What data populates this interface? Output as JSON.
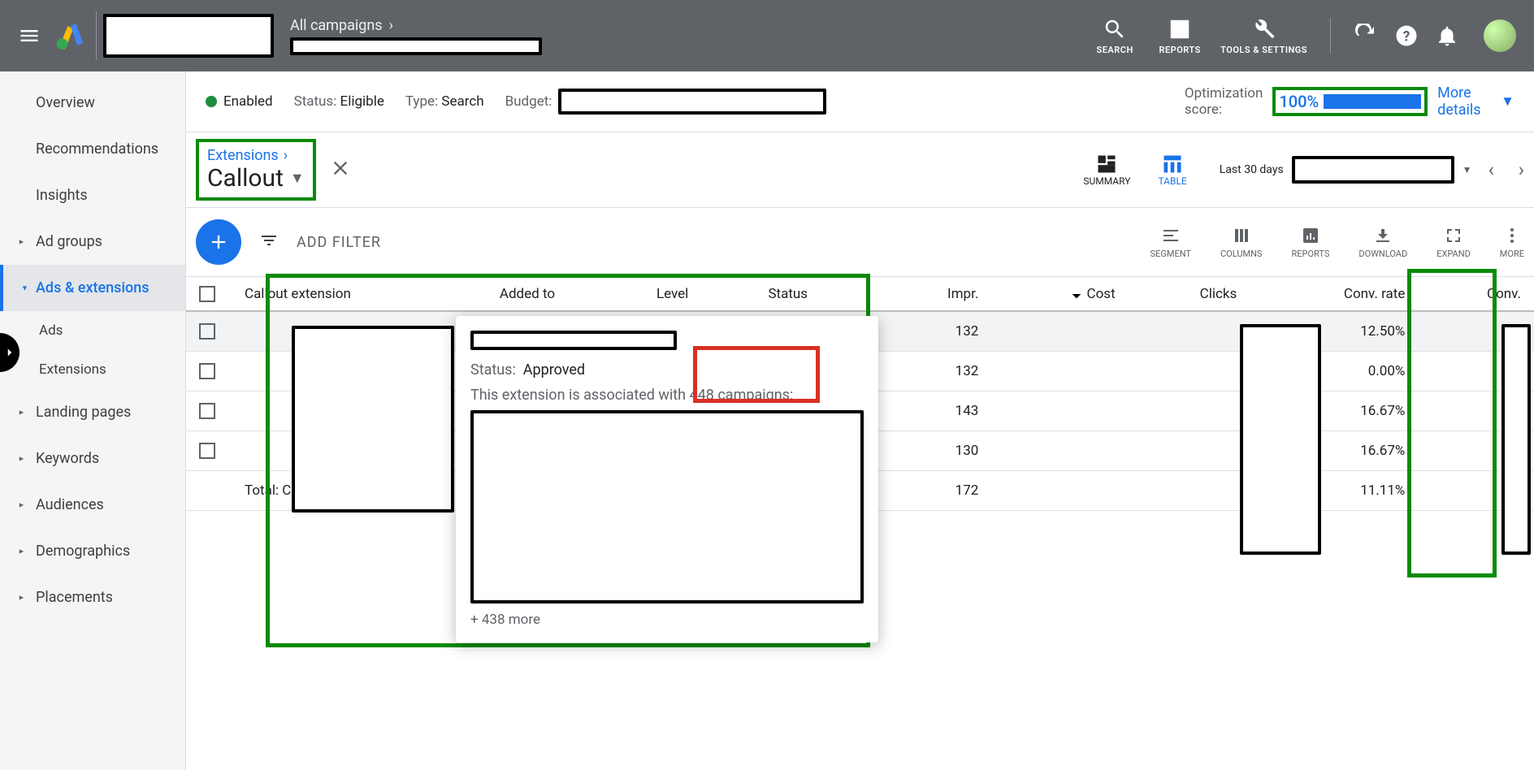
{
  "header": {
    "hamburger_name": "menu-icon",
    "crumb_top": "All campaigns",
    "tools": {
      "search": "SEARCH",
      "reports": "REPORTS",
      "tools_settings": "TOOLS & SETTINGS"
    }
  },
  "sidebar": {
    "overview": "Overview",
    "recommendations": "Recommendations",
    "insights": "Insights",
    "ad_groups": "Ad groups",
    "ads_extensions": "Ads & extensions",
    "ads": "Ads",
    "extensions": "Extensions",
    "landing_pages": "Landing pages",
    "keywords": "Keywords",
    "audiences": "Audiences",
    "demographics": "Demographics",
    "placements": "Placements"
  },
  "campaign_bar": {
    "enabled": "Enabled",
    "status_label": "Status:",
    "status_value": "Eligible",
    "type_label": "Type:",
    "type_value": "Search",
    "budget_label": "Budget:",
    "opt_label_1": "Optimization",
    "opt_label_2": "score:",
    "opt_value": "100%",
    "more_details": "More details"
  },
  "ext_bar": {
    "extensions_link": "Extensions",
    "type": "Callout",
    "summary": "SUMMARY",
    "table": "TABLE",
    "date_prefix": "Last 30 days"
  },
  "filter_bar": {
    "add_filter": "ADD FILTER",
    "segment": "SEGMENT",
    "columns": "COLUMNS",
    "reports": "REPORTS",
    "download": "DOWNLOAD",
    "expand": "EXPAND",
    "more": "MORE"
  },
  "table": {
    "headers": {
      "callout": "Callout extension",
      "added_to": "Added to",
      "level": "Level",
      "status": "Status",
      "impr": "Impr.",
      "cost": "Cost",
      "clicks": "Clicks",
      "conv_rate": "Conv. rate",
      "conv": "Conv."
    },
    "rows": [
      {
        "impr": "132",
        "conv_rate": "12.50%"
      },
      {
        "impr": "132",
        "conv_rate": "0.00%"
      },
      {
        "impr": "143",
        "conv_rate": "16.67%"
      },
      {
        "impr": "130",
        "conv_rate": "16.67%"
      }
    ],
    "total_label": "Total: Callout extensions",
    "total": {
      "impr": "172",
      "conv_rate": "11.11%"
    }
  },
  "popover": {
    "status_label": "Status:",
    "status_value": "Approved",
    "assoc_text": "This extension is associated with 448 campaigns:",
    "more_text": "+ 438 more"
  }
}
